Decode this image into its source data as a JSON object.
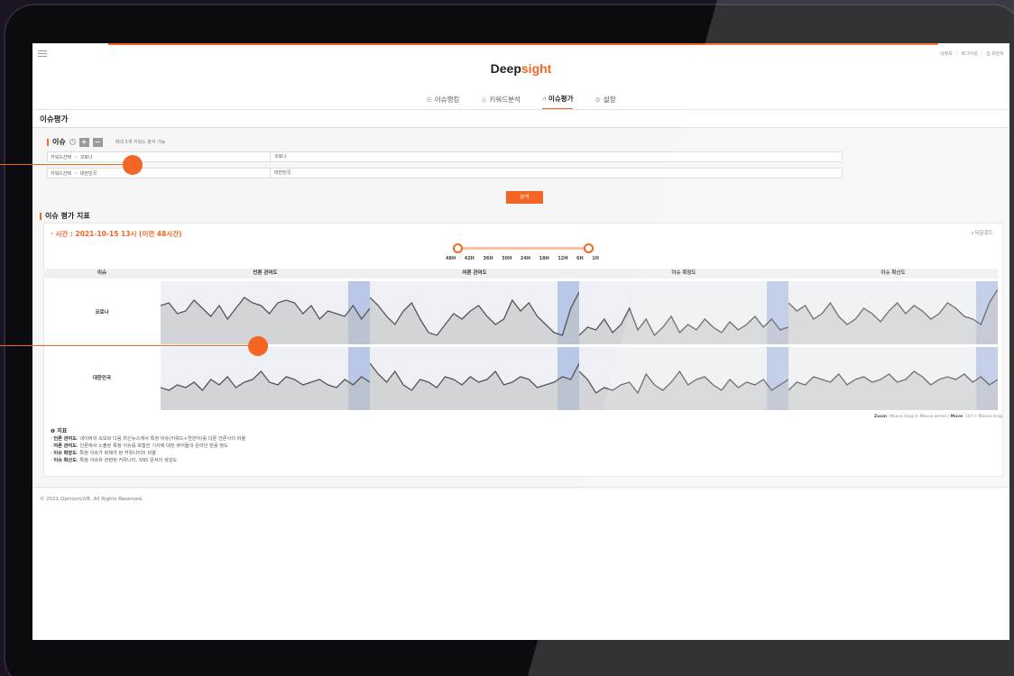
{
  "util_links": [
    "내정보",
    "로그아웃",
    "프린트"
  ],
  "logo": {
    "main": "Deep",
    "accent": "sight"
  },
  "nav": [
    {
      "label": "이슈랭킹",
      "icon": "list-icon",
      "active": false
    },
    {
      "label": "키워드분석",
      "icon": "target-icon",
      "active": false
    },
    {
      "label": "이슈평가",
      "icon": "line-chart-icon",
      "active": true
    },
    {
      "label": "설정",
      "icon": "gear-icon",
      "active": false
    }
  ],
  "page_title": "이슈평가",
  "issue": {
    "label": "이슈",
    "add": "+",
    "remove": "−",
    "hint": "최대 5개 키워드 분석 가능",
    "rows": [
      {
        "select": "키워드선택",
        "keyword": "코로나",
        "value": "코로나"
      },
      {
        "select": "키워드선택",
        "keyword": "대한민국",
        "value": "대한민국"
      }
    ]
  },
  "analyze_button": "분석",
  "section_title": "이슈 평가 지표",
  "time_label": "· 시간 : 2021-10-15 13시 (이전 48시간)",
  "download": "다운로드",
  "time_ticks": [
    "48H",
    "42H",
    "36H",
    "30H",
    "24H",
    "18H",
    "12H",
    "6H",
    "1H"
  ],
  "grid": {
    "headers": [
      "이슈",
      "언론 관여도",
      "여론 관여도",
      "이슈 확장도",
      "이슈 확산도"
    ],
    "rows": [
      "코로나",
      "대한민국"
    ]
  },
  "zoom_note": {
    "zoom": "Zoom",
    "zoom_text": ": Mouse drag or Mouse wheel / ",
    "move": "Move",
    "move_text": ": Ctrl + Mouse drag"
  },
  "legend": {
    "title": "지표",
    "items": [
      {
        "term": "언론 관여도",
        "desc": ": 네이버의 속보와 다음 최신뉴스에서 특정 이슈(키워드+연관어)를 다룬 언론사의 비율"
      },
      {
        "term": "여론 관여도",
        "desc": ": 언론에서 노출된 특정 이슈를 포함한 기사에 대한 뷰어들의 온라인 반응 정도"
      },
      {
        "term": "이슈 확장도",
        "desc": ": 특정 이슈가 화제가 된 커뮤니티의 비율"
      },
      {
        "term": "이슈 확산도",
        "desc": ": 특정 이슈와 관련된 커뮤니티, SNS 문서의 생성도"
      }
    ]
  },
  "footer": "© 2021 OpinionLIVE. All Rights Reserved.",
  "colors": {
    "accent": "#f26522",
    "highlight": "#b9c8e6",
    "area": "#dcdcdc",
    "line": "#555555"
  }
}
